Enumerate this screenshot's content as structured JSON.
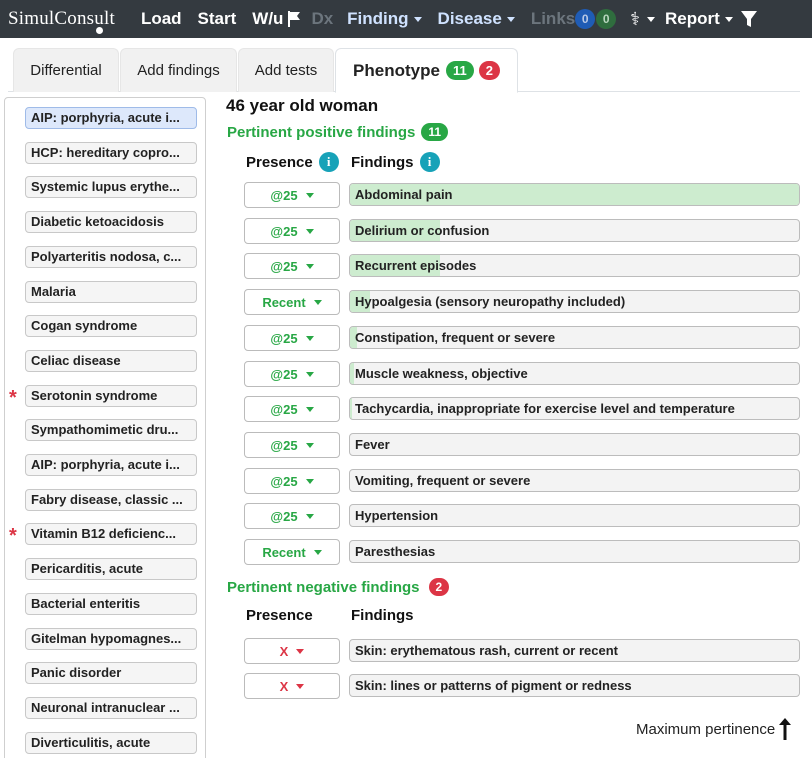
{
  "navbar": {
    "brand": "SimulConsult",
    "items": {
      "load": "Load",
      "start": "Start",
      "wu": "W/u",
      "dx": "Dx",
      "finding": "Finding",
      "disease": "Disease",
      "links": "Links",
      "links_blue_count": "0",
      "links_green_count": "0",
      "report": "Report"
    }
  },
  "tabs": {
    "differential": "Differential",
    "add_findings": "Add findings",
    "add_tests": "Add tests",
    "phenotype": "Phenotype",
    "phenotype_positive_count": "11",
    "phenotype_negative_count": "2"
  },
  "sidebar": {
    "diagnoses": [
      {
        "label": "AIP: porphyria, acute i...",
        "selected": true,
        "flagged": false
      },
      {
        "label": "HCP: hereditary copro...",
        "selected": false,
        "flagged": false
      },
      {
        "label": "Systemic lupus erythe...",
        "selected": false,
        "flagged": false
      },
      {
        "label": "Diabetic ketoacidosis",
        "selected": false,
        "flagged": false
      },
      {
        "label": "Polyarteritis nodosa, c...",
        "selected": false,
        "flagged": false
      },
      {
        "label": "Malaria",
        "selected": false,
        "flagged": false
      },
      {
        "label": "Cogan syndrome",
        "selected": false,
        "flagged": false
      },
      {
        "label": "Celiac disease",
        "selected": false,
        "flagged": false
      },
      {
        "label": "Serotonin syndrome",
        "selected": false,
        "flagged": true
      },
      {
        "label": "Sympathomimetic dru...",
        "selected": false,
        "flagged": false
      },
      {
        "label": "AIP: porphyria, acute i...",
        "selected": false,
        "flagged": false
      },
      {
        "label": "Fabry disease, classic ...",
        "selected": false,
        "flagged": false
      },
      {
        "label": "Vitamin B12 deficienc...",
        "selected": false,
        "flagged": true
      },
      {
        "label": "Pericarditis, acute",
        "selected": false,
        "flagged": false
      },
      {
        "label": "Bacterial enteritis",
        "selected": false,
        "flagged": false
      },
      {
        "label": "Gitelman hypomagnes...",
        "selected": false,
        "flagged": false
      },
      {
        "label": "Panic disorder",
        "selected": false,
        "flagged": false
      },
      {
        "label": "Neuronal intranuclear ...",
        "selected": false,
        "flagged": false
      },
      {
        "label": "Diverticulitis, acute",
        "selected": false,
        "flagged": false
      }
    ],
    "flag_symbol": "*"
  },
  "main": {
    "patient": "46 year old woman",
    "positive": {
      "title": "Pertinent positive findings",
      "count": "11",
      "col_presence": "Presence",
      "col_findings": "Findings",
      "rows": [
        {
          "presence": "@25",
          "finding": "Abdominal pain",
          "pertinence": 1.0
        },
        {
          "presence": "@25",
          "finding": "Delirium or confusion",
          "pertinence": 0.2
        },
        {
          "presence": "@25",
          "finding": "Recurrent episodes",
          "pertinence": 0.2
        },
        {
          "presence": "Recent",
          "finding": "Hypoalgesia (sensory neuropathy included)",
          "pertinence": 0.045
        },
        {
          "presence": "@25",
          "finding": "Constipation, frequent or severe",
          "pertinence": 0.015
        },
        {
          "presence": "@25",
          "finding": "Muscle weakness, objective",
          "pertinence": 0.01
        },
        {
          "presence": "@25",
          "finding": "Tachycardia, inappropriate for exercise level and temperature",
          "pertinence": 0.005
        },
        {
          "presence": "@25",
          "finding": "Fever",
          "pertinence": 0
        },
        {
          "presence": "@25",
          "finding": "Vomiting, frequent or severe",
          "pertinence": 0
        },
        {
          "presence": "@25",
          "finding": "Hypertension",
          "pertinence": 0
        },
        {
          "presence": "Recent",
          "finding": "Paresthesias",
          "pertinence": 0
        }
      ]
    },
    "negative": {
      "title": "Pertinent negative findings",
      "count": "2",
      "col_presence": "Presence",
      "col_findings": "Findings",
      "rows": [
        {
          "presence": "X",
          "finding": "Skin: erythematous rash, current or recent",
          "pertinence": 0
        },
        {
          "presence": "X",
          "finding": "Skin: lines or patterns of pigment or redness",
          "pertinence": 0
        }
      ]
    },
    "max_pertinence": "Maximum pertinence"
  },
  "colors": {
    "navbar_bg": "#343a40",
    "accent_green": "#28a745",
    "accent_red": "#dc3545",
    "info_blue": "#17a2b8",
    "pertinence_fill": "#cdeccf"
  },
  "icons": [
    "flag-icon",
    "dna-icon",
    "filter-icon",
    "info-icon",
    "caret-down-icon",
    "arrow-up-icon"
  ]
}
